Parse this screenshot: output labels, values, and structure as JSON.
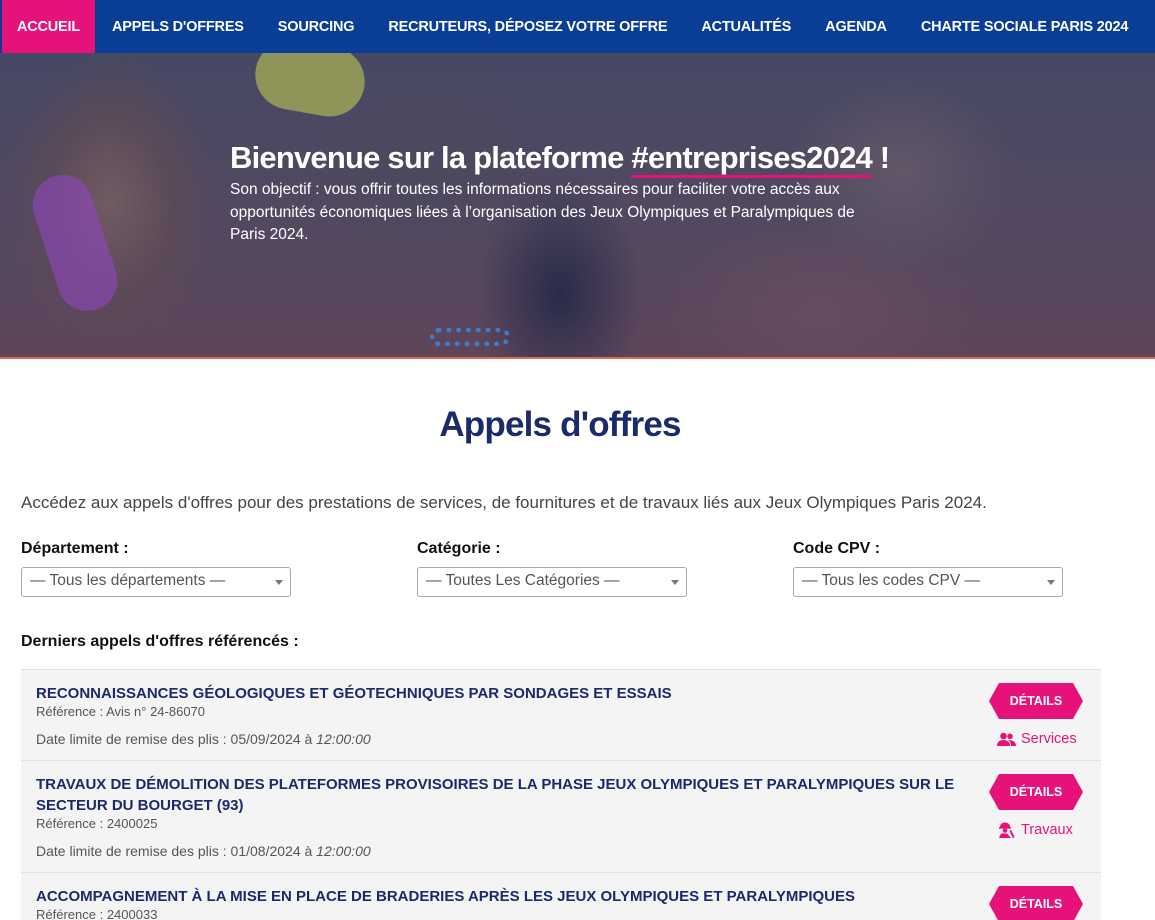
{
  "nav": {
    "items": [
      {
        "label": "ACCUEIL",
        "active": true
      },
      {
        "label": "APPELS D'OFFRES"
      },
      {
        "label": "SOURCING"
      },
      {
        "label": "RECRUTEURS, DÉPOSEZ VOTRE OFFRE"
      },
      {
        "label": "ACTUALITÉS"
      },
      {
        "label": "AGENDA"
      },
      {
        "label": "CHARTE SOCIALE PARIS 2024"
      }
    ]
  },
  "hero": {
    "title_prefix": "Bienvenue sur la plateforme ",
    "title_tag": "#entreprises2024",
    "title_suffix": " !",
    "subtitle": "Son objectif : vous offrir toutes les informations nécessaires pour faciliter votre accès aux opportunités économiques liées à l’organisation des Jeux Olympiques et Paralympiques de Paris 2024."
  },
  "section": {
    "title": "Appels d'offres",
    "intro": "Accédez aux appels d'offres pour des prestations de services, de fournitures et de travaux liés aux Jeux Olympiques Paris 2024."
  },
  "filters": [
    {
      "label": "Département :",
      "value": "— Tous les départements —"
    },
    {
      "label": "Catégorie :",
      "value": "— Toutes Les Catégories —"
    },
    {
      "label": "Code CPV :",
      "value": "— Tous les codes CPV —"
    }
  ],
  "list": {
    "heading": "Derniers appels d'offres référencés :",
    "details_label": "DÉTAILS",
    "date_prefix": "Date limite de remise des plis : ",
    "offers": [
      {
        "title": "RECONNAISSANCES GÉOLOGIQUES ET GÉOTECHNIQUES PAR SONDAGES ET ESSAIS",
        "ref": "Référence : Avis n° 24-86070",
        "date": "05/09/2024 à ",
        "time": "12:00:00",
        "category": "Services",
        "category_icon": "users-icon"
      },
      {
        "title": "TRAVAUX DE DÉMOLITION DES PLATEFORMES PROVISOIRES DE LA PHASE JEUX OLYMPIQUES ET PARALYMPIQUES SUR LE SECTEUR DU BOURGET (93)",
        "ref": "Référence : 2400025",
        "date": "01/08/2024 à ",
        "time": "12:00:00",
        "category": "Travaux",
        "category_icon": "worker-icon"
      },
      {
        "title": "ACCOMPAGNEMENT À LA MISE EN PLACE DE BRADERIES APRÈS LES JEUX OLYMPIQUES ET PARALYMPIQUES",
        "ref": "Référence : 2400033"
      }
    ]
  },
  "colors": {
    "nav_bg": "#0a3d96",
    "accent": "#e6127a",
    "title": "#1b2a6b"
  }
}
